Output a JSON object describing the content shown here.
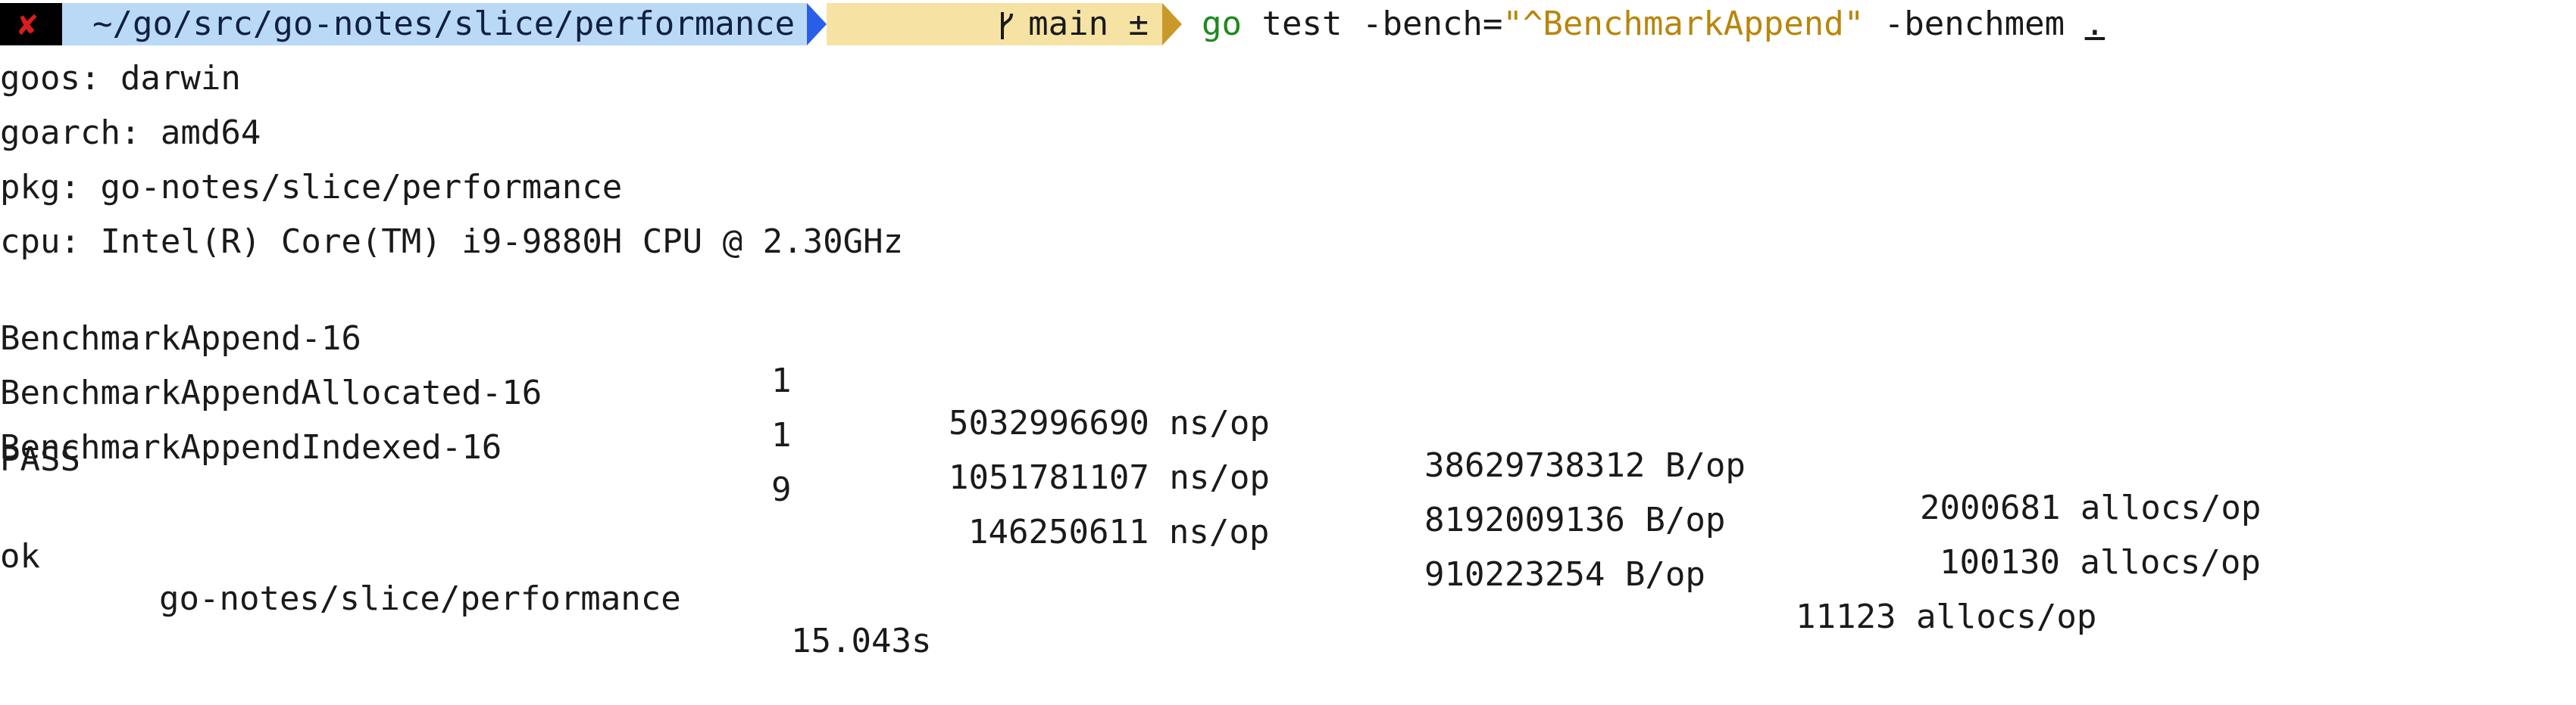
{
  "prompt": {
    "status_symbol": "✘",
    "directory": "~/go/src/go-notes/slice/performance",
    "branch_icon": "branch-icon",
    "branch": "main ±",
    "command": {
      "program": "go",
      "args_before": " test -bench=",
      "quoted_arg": "\"^BenchmarkAppend\"",
      "args_after": " -benchmem ",
      "target": "."
    },
    "colors": {
      "status_bg": "#000000",
      "status_fg": "#d81e1e",
      "dir_bg": "#b9d9f7",
      "dir_arrow": "#2b5ee8",
      "git_bg": "#f6e3a4",
      "git_arrow": "#c99a2a",
      "go": "#1c8a1c",
      "string": "#b8860b"
    }
  },
  "info": [
    "goos: darwin",
    "goarch: amd64",
    "pkg: go-notes/slice/performance",
    "cpu: Intel(R) Core(TM) i9-9880H CPU @ 2.30GHz"
  ],
  "benchmarks": [
    {
      "name": "BenchmarkAppend-16",
      "iterations": "1",
      "ns": "5032996690 ns/op",
      "bytes": "38629738312 B/op",
      "allocs": "2000681 allocs/op"
    },
    {
      "name": "BenchmarkAppendAllocated-16",
      "iterations": "1",
      "ns": "1051781107 ns/op",
      "bytes": "8192009136 B/op",
      "allocs": "100130 allocs/op"
    },
    {
      "name": "BenchmarkAppendIndexed-16",
      "iterations": "9",
      "ns": "146250611 ns/op",
      "bytes": "910223254 B/op",
      "allocs": "11123 allocs/op"
    }
  ],
  "result": {
    "pass": "PASS",
    "ok_label": "ok",
    "ok_package": "go-notes/slice/performance",
    "ok_time": "15.043s"
  }
}
